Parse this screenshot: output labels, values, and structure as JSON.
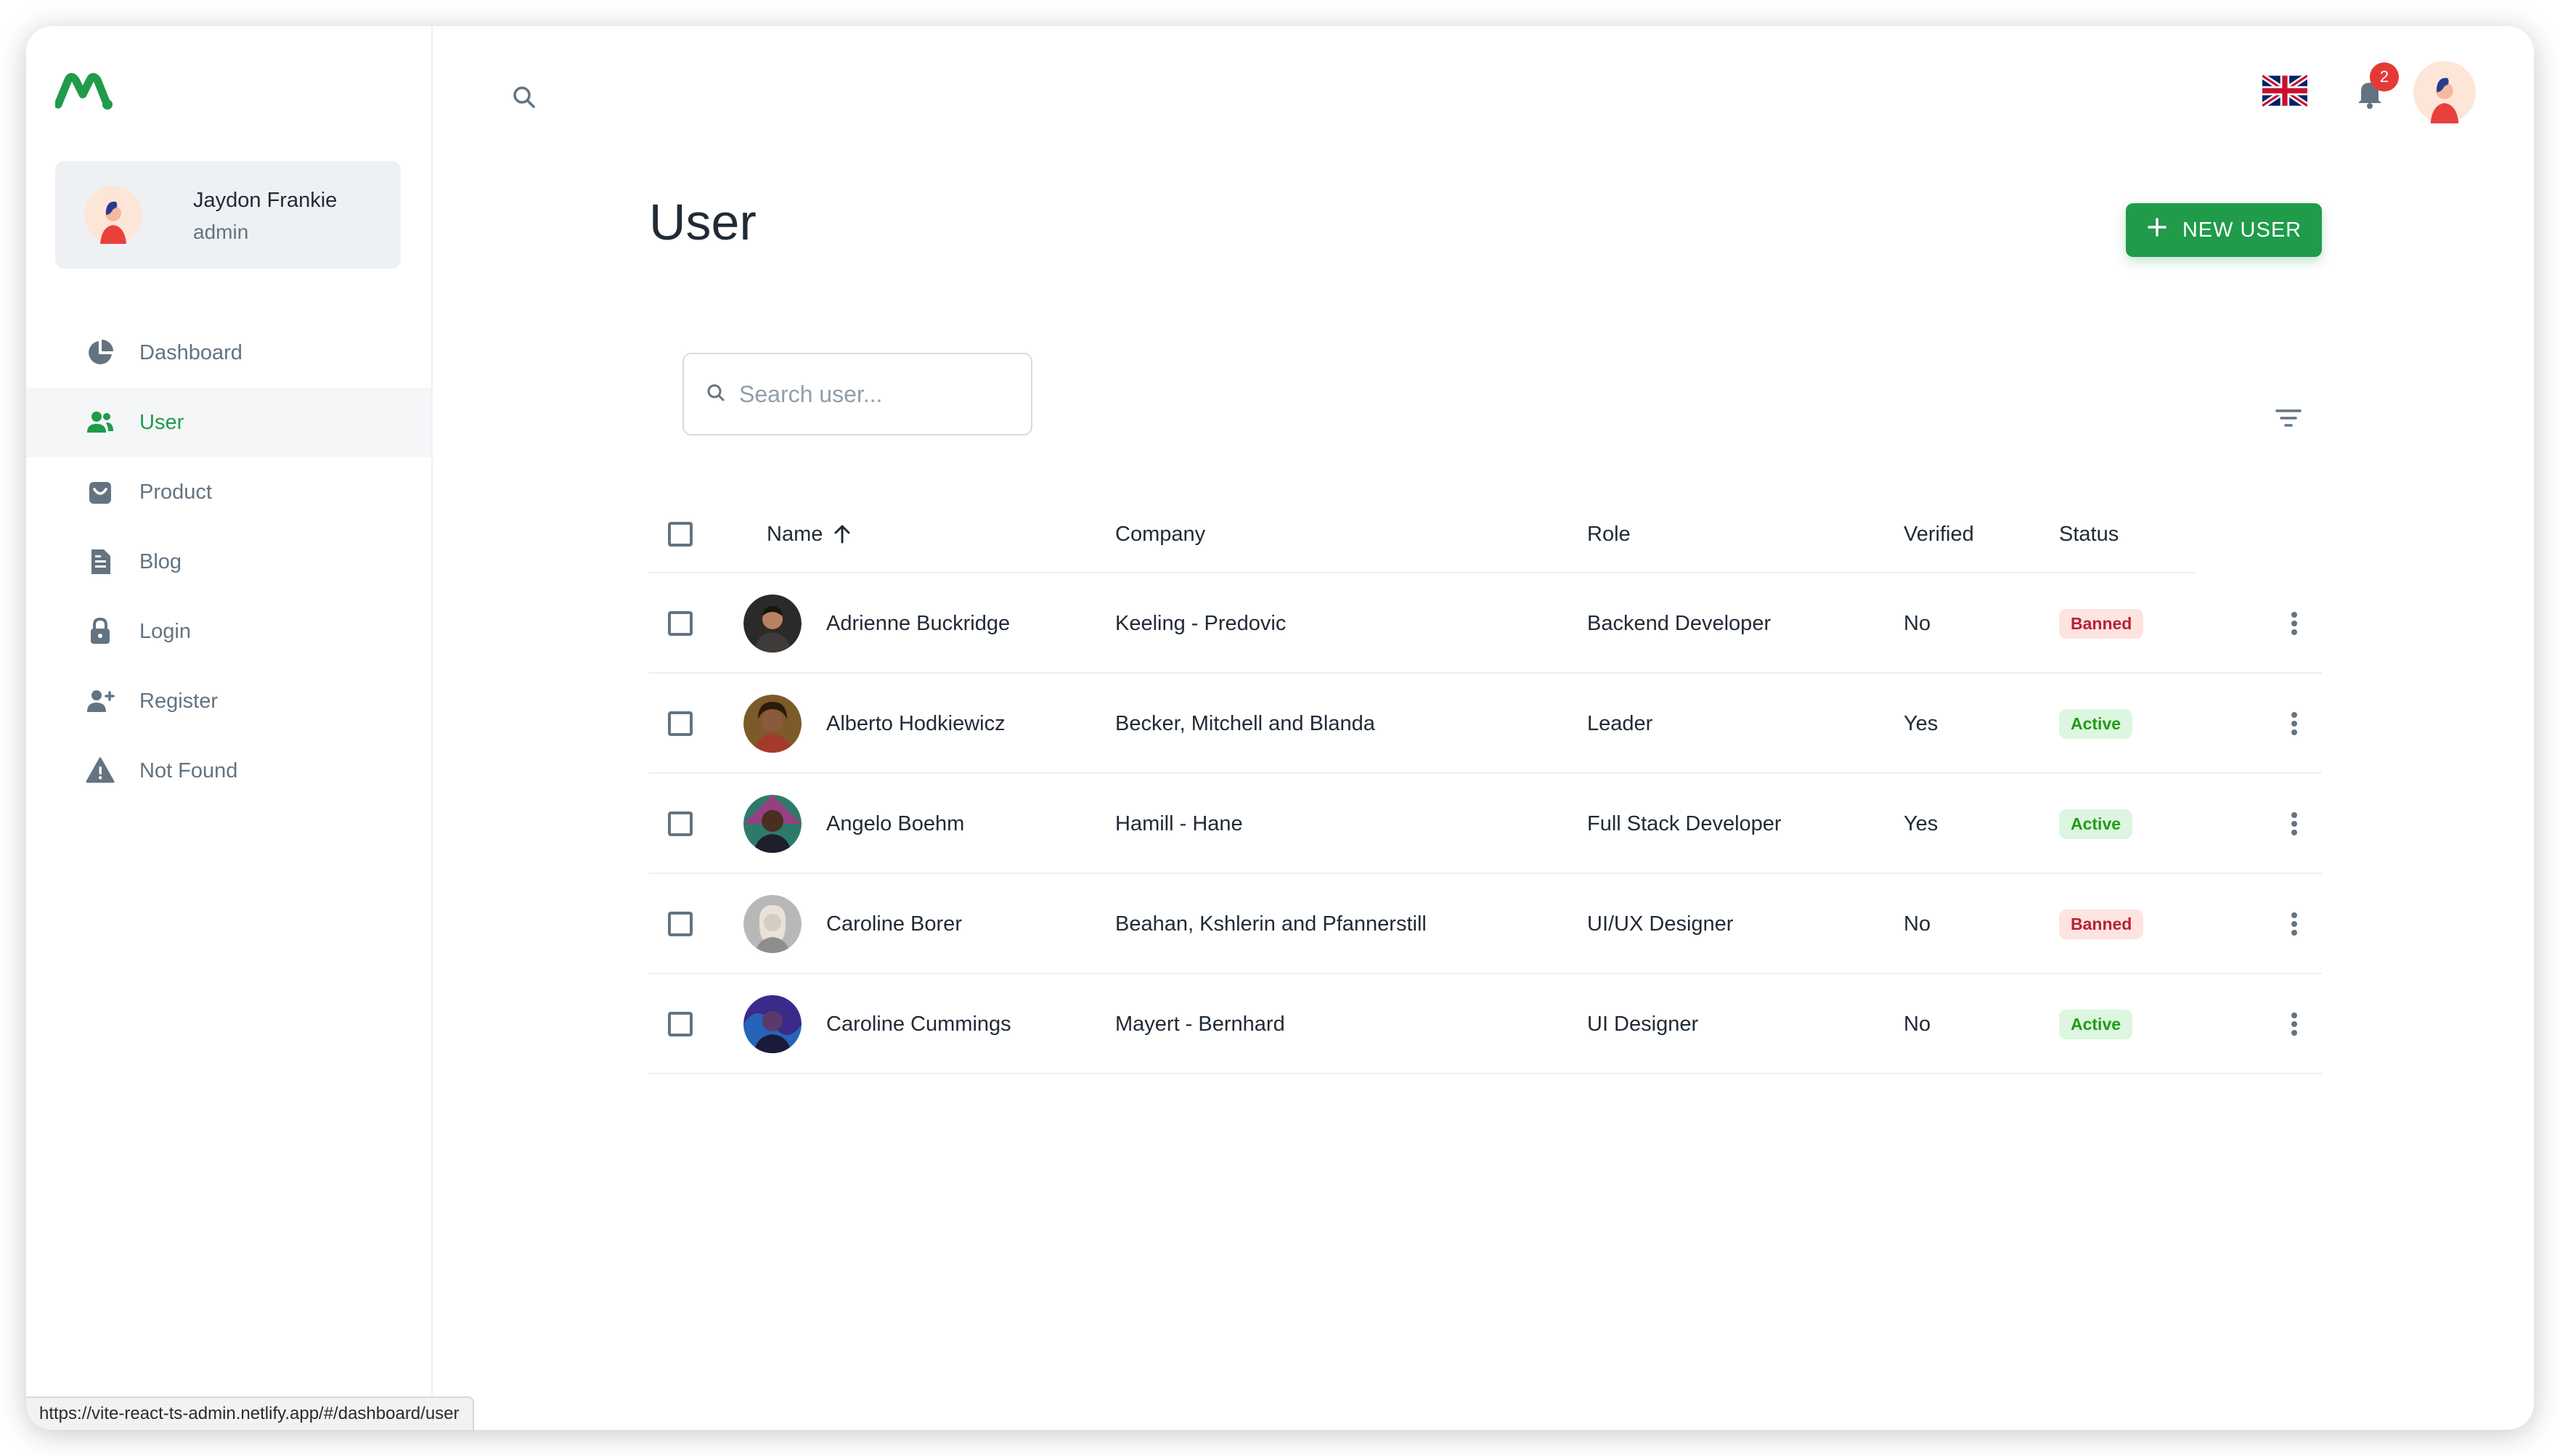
{
  "account": {
    "name": "Jaydon Frankie",
    "role": "admin"
  },
  "nav": [
    {
      "label": "Dashboard",
      "icon": "pie-chart-icon",
      "active": false
    },
    {
      "label": "User",
      "icon": "people-icon",
      "active": true
    },
    {
      "label": "Product",
      "icon": "shopping-bag-icon",
      "active": false
    },
    {
      "label": "Blog",
      "icon": "file-text-icon",
      "active": false
    },
    {
      "label": "Login",
      "icon": "lock-icon",
      "active": false
    },
    {
      "label": "Register",
      "icon": "person-add-icon",
      "active": false
    },
    {
      "label": "Not Found",
      "icon": "alert-triangle-icon",
      "active": false
    }
  ],
  "header": {
    "notification_count": "2",
    "language": "uk-flag-icon"
  },
  "page": {
    "title": "User",
    "new_user_label": "NEW USER"
  },
  "search": {
    "placeholder": "Search user..."
  },
  "table": {
    "columns": {
      "name": "Name",
      "company": "Company",
      "role": "Role",
      "verified": "Verified",
      "status": "Status"
    },
    "rows": [
      {
        "name": "Adrienne Buckridge",
        "company": "Keeling - Predovic",
        "role": "Backend Developer",
        "verified": "No",
        "status": "Banned"
      },
      {
        "name": "Alberto Hodkiewicz",
        "company": "Becker, Mitchell and Blanda",
        "role": "Leader",
        "verified": "Yes",
        "status": "Active"
      },
      {
        "name": "Angelo Boehm",
        "company": "Hamill - Hane",
        "role": "Full Stack Developer",
        "verified": "Yes",
        "status": "Active"
      },
      {
        "name": "Caroline Borer",
        "company": "Beahan, Kshlerin and Pfannerstill",
        "role": "UI/UX Designer",
        "verified": "No",
        "status": "Banned"
      },
      {
        "name": "Caroline Cummings",
        "company": "Mayert - Bernhard",
        "role": "UI Designer",
        "verified": "No",
        "status": "Active"
      }
    ]
  },
  "status_bar": {
    "url": "https://vite-react-ts-admin.netlify.app/#/dashboard/user"
  },
  "colors": {
    "accent": "#1f9b4a",
    "banned_bg": "#fde4e0",
    "banned_text": "#b72136",
    "active_bg": "#dcf6df",
    "active_text": "#229a16"
  }
}
